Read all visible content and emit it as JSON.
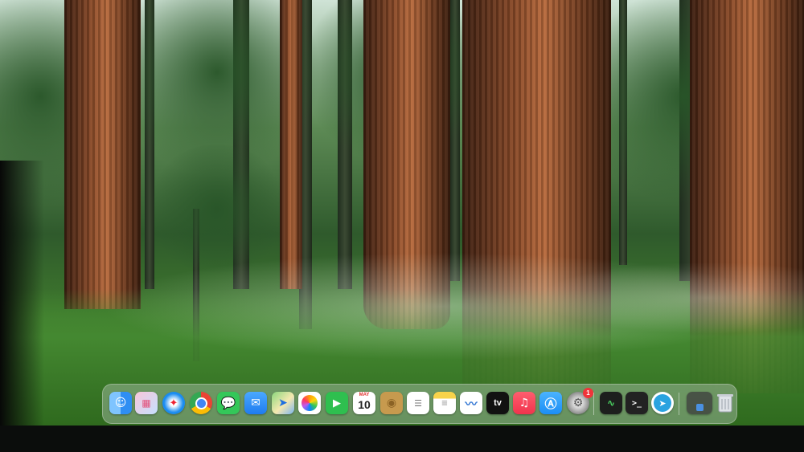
{
  "desktop": {
    "wallpaper": "redwood-forest"
  },
  "dock": {
    "apps": [
      {
        "name": "Finder",
        "icon": "finder-icon"
      },
      {
        "name": "Launchpad",
        "icon": "launchpad-icon"
      },
      {
        "name": "Safari",
        "icon": "safari-icon"
      },
      {
        "name": "Google Chrome",
        "icon": "chrome-icon"
      },
      {
        "name": "Messages",
        "icon": "messages-icon"
      },
      {
        "name": "Mail",
        "icon": "mail-icon"
      },
      {
        "name": "Maps",
        "icon": "maps-icon"
      },
      {
        "name": "Photos",
        "icon": "photos-icon"
      },
      {
        "name": "FaceTime",
        "icon": "facetime-icon"
      },
      {
        "name": "Calendar",
        "icon": "calendar-icon",
        "month": "MAY",
        "day": "10"
      },
      {
        "name": "Contacts",
        "icon": "contacts-icon"
      },
      {
        "name": "Reminders",
        "icon": "reminders-icon"
      },
      {
        "name": "Notes",
        "icon": "notes-icon"
      },
      {
        "name": "Freeform",
        "icon": "freeform-icon"
      },
      {
        "name": "TV",
        "icon": "apple-tv-icon",
        "label": "tv"
      },
      {
        "name": "Music",
        "icon": "music-icon"
      },
      {
        "name": "App Store",
        "icon": "app-store-icon"
      },
      {
        "name": "System Settings",
        "icon": "system-settings-icon",
        "badge": "1"
      },
      {
        "name": "Activity Monitor",
        "icon": "activity-monitor-icon"
      },
      {
        "name": "Terminal",
        "icon": "terminal-icon"
      },
      {
        "name": "Telegram",
        "icon": "telegram-icon"
      },
      {
        "name": "Downloads",
        "icon": "downloads-stack-icon"
      },
      {
        "name": "Trash",
        "icon": "trash-icon"
      }
    ],
    "colors": {
      "finder": "#2f8ef3",
      "safari": "#1a8cf0",
      "messages": "#34c759",
      "mail": "#1f7cf0",
      "facetime": "#2fbf4f",
      "music": "#f0344d",
      "app_store": "#1c8ef5",
      "telegram": "#2aa3e0",
      "badge": "#f0343a"
    }
  }
}
